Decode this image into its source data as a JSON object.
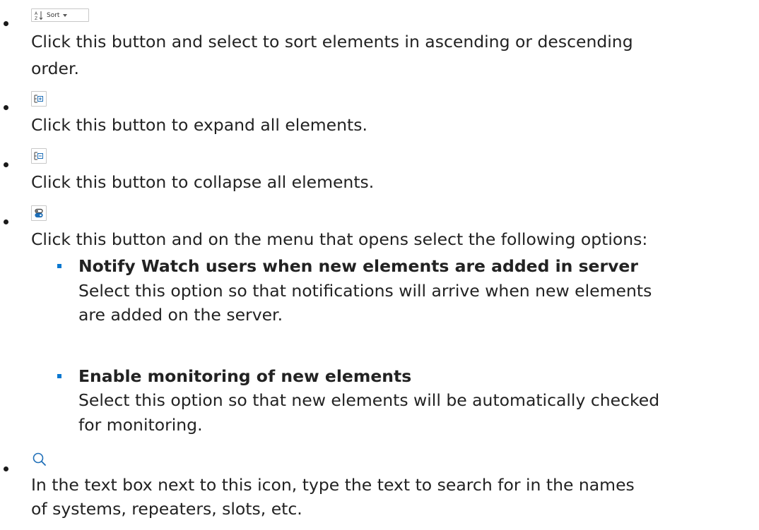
{
  "items": [
    {
      "icon": "sort-az-icon",
      "button_label": "Sort",
      "lines": [
        "Click this button and select to sort elements in ascending or descending",
        "order."
      ]
    },
    {
      "icon": "expand-all-icon",
      "lines": [
        "Click this button to expand all elements."
      ]
    },
    {
      "icon": "collapse-all-icon",
      "lines": [
        "Click this button to collapse all elements."
      ]
    },
    {
      "icon": "toggle-options-icon",
      "lines": [
        "Click this button and on the menu that opens select the following options:"
      ],
      "options": [
        {
          "title": "Notify Watch users when new elements are added in server",
          "lines": [
            "Select this option so that notifications will arrive when new elements",
            "are added on the server."
          ]
        },
        {
          "title": "Enable monitoring of new elements",
          "lines": [
            "Select this option so that new elements will be automatically checked",
            "for monitoring."
          ]
        }
      ]
    },
    {
      "icon": "search-icon",
      "lines": [
        "In the text box next to this icon, type the text to search for in the names",
        "of systems, repeaters, slots, etc."
      ]
    }
  ],
  "colors": {
    "text": "#222222",
    "square_bullet": "#0b78d0",
    "icon_blue": "#1f6fb8"
  }
}
